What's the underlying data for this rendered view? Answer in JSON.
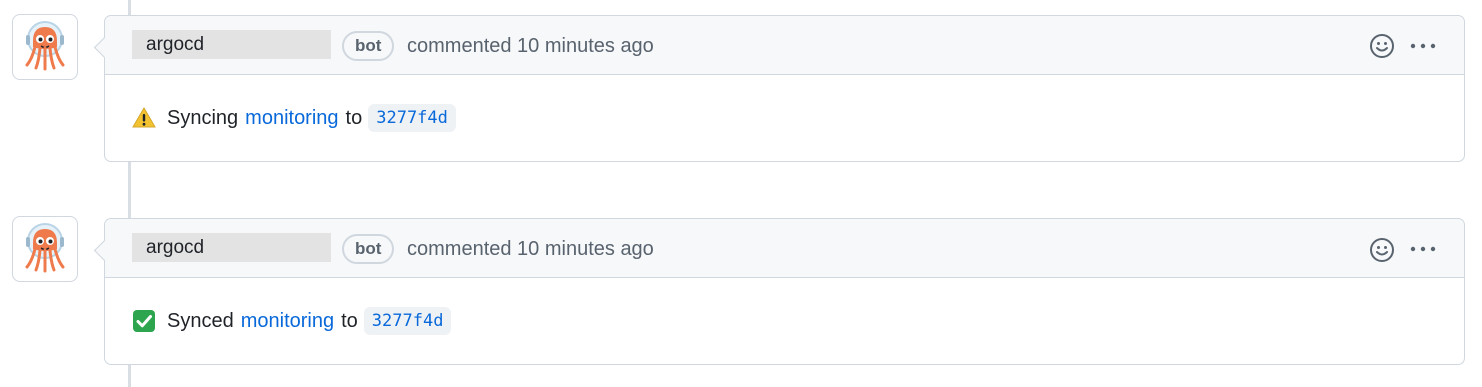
{
  "comments": [
    {
      "author": "argocd",
      "badge": "bot",
      "meta": "commented 10 minutes ago",
      "status_icon": "warning-icon",
      "status_verb": "Syncing",
      "app_link": "monitoring",
      "connector": "to",
      "commit_sha": "3277f4d"
    },
    {
      "author": "argocd",
      "badge": "bot",
      "meta": "commented 10 minutes ago",
      "status_icon": "check-mark-icon",
      "status_verb": "Synced",
      "app_link": "monitoring",
      "connector": "to",
      "commit_sha": "3277f4d"
    }
  ],
  "colors": {
    "link": "#0969da",
    "header_bg": "#f6f8fa",
    "border": "#d0d7de",
    "muted_text": "#59636e",
    "warning": "#d4a72c",
    "success": "#2da44e",
    "avatar_orange": "#ef7b4d"
  }
}
